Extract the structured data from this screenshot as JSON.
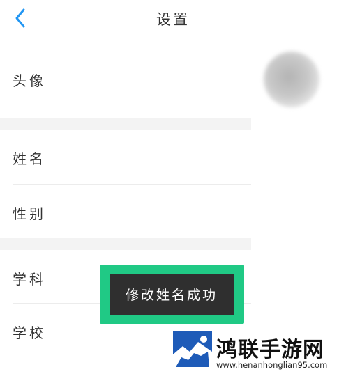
{
  "header": {
    "title": "设置",
    "back_icon": "chevron-left-icon",
    "accent_color": "#2196f3"
  },
  "rows": [
    {
      "label": "头像"
    },
    {
      "label": "姓名"
    },
    {
      "label": "性别"
    },
    {
      "label": "学科"
    },
    {
      "label": "学校"
    }
  ],
  "toast": {
    "message": "修改姓名成功",
    "highlight_color": "#20c985"
  },
  "watermark": {
    "title": "鸿联手游网",
    "url": "www.henanhonglian95.com"
  }
}
